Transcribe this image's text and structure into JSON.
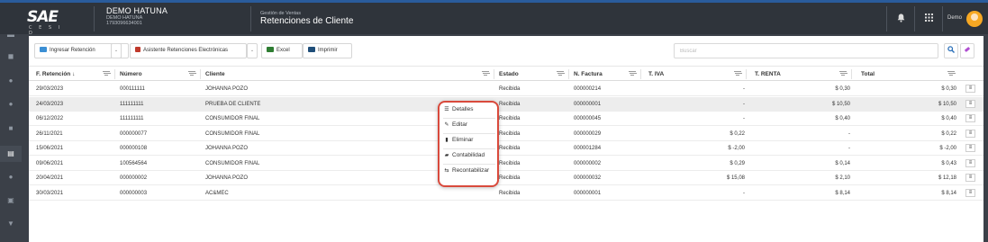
{
  "header": {
    "logo_text": "SAE",
    "logo_sub": "C E S I D",
    "company_name": "DEMO HATUNA",
    "company_sub1": "DEMO HATUNA",
    "company_sub2": "1793096634001",
    "module_small": "Gestión de Ventas",
    "module_title": "Retenciones de Cliente",
    "user_name": "Demo",
    "icons": [
      "bell-icon",
      "apps-grid-icon",
      "avatar"
    ]
  },
  "sidebar": {
    "icons": [
      "home-icon",
      "dashboard-icon",
      "users-icon",
      "people-icon",
      "cart-icon",
      "box-icon",
      "file-icon",
      "shield-icon"
    ]
  },
  "toolbar": {
    "ingresar_label": "Ingresar Retención",
    "asistente_label": "Asistente Retenciones Electrónicas",
    "excel_label": "Excel",
    "imprimir_label": "Imprimir",
    "search_placeholder": "Buscar",
    "colors": {
      "ingresar": "#3b8fd4",
      "asistente": "#c0392b",
      "excel": "#2e7d32",
      "imprimir": "#1f4e79"
    }
  },
  "table": {
    "columns": [
      "F. Retención",
      "Número",
      "Cliente",
      "Estado",
      "N. Factura",
      "T. IVA",
      "T. RENTA",
      "Total"
    ],
    "sort_indicator": "↓",
    "rows": [
      {
        "fecha": "29/03/2023",
        "numero": "000111111",
        "cliente": "JOHANNA POZO",
        "estado": "Recibida",
        "factura": "000000214",
        "iva": "-",
        "renta": "$ 0,30",
        "total": "$ 0,30"
      },
      {
        "fecha": "24/03/2023",
        "numero": "111111111",
        "cliente": "PRUEBA DE CLIENTE",
        "estado": "Recibida",
        "factura": "000000001",
        "iva": "-",
        "renta": "$ 10,50",
        "total": "$ 10,50"
      },
      {
        "fecha": "06/12/2022",
        "numero": "111111111",
        "cliente": "CONSUMIDOR FINAL",
        "estado": "Recibida",
        "factura": "000000045",
        "iva": "-",
        "renta": "$ 0,40",
        "total": "$ 0,40"
      },
      {
        "fecha": "26/11/2021",
        "numero": "000000077",
        "cliente": "CONSUMIDOR FINAL",
        "estado": "Recibida",
        "factura": "000000029",
        "iva": "$ 0,22",
        "renta": "-",
        "total": "$ 0,22"
      },
      {
        "fecha": "15/06/2021",
        "numero": "000000108",
        "cliente": "JOHANNA POZO",
        "estado": "Recibida",
        "factura": "000001284",
        "iva": "$ -2,00",
        "renta": "-",
        "total": "$ -2,00"
      },
      {
        "fecha": "09/06/2021",
        "numero": "100564564",
        "cliente": "CONSUMIDOR FINAL",
        "estado": "Recibida",
        "factura": "000000002",
        "iva": "$ 0,29",
        "renta": "$ 0,14",
        "total": "$ 0,43"
      },
      {
        "fecha": "20/04/2021",
        "numero": "000000002",
        "cliente": "JOHANNA POZO",
        "estado": "Recibida",
        "factura": "000000032",
        "iva": "$ 15,08",
        "renta": "$ 2,10",
        "total": "$ 12,18"
      },
      {
        "fecha": "30/03/2021",
        "numero": "000000003",
        "cliente": "AC&MEC",
        "estado": "Recibida",
        "factura": "000000001",
        "iva": "-",
        "renta": "$ 8,14",
        "total": "$ 8,14"
      }
    ]
  },
  "context_menu": {
    "items": [
      {
        "label": "Detalles",
        "icon": "list-icon"
      },
      {
        "label": "Editar",
        "icon": "pencil-icon"
      },
      {
        "label": "Eliminar",
        "icon": "trash-icon"
      },
      {
        "label": "Contabilidad",
        "icon": "book-icon"
      },
      {
        "label": "Recontabilizar",
        "icon": "refresh-icon"
      }
    ],
    "highlight_color": "#d94a3c"
  }
}
